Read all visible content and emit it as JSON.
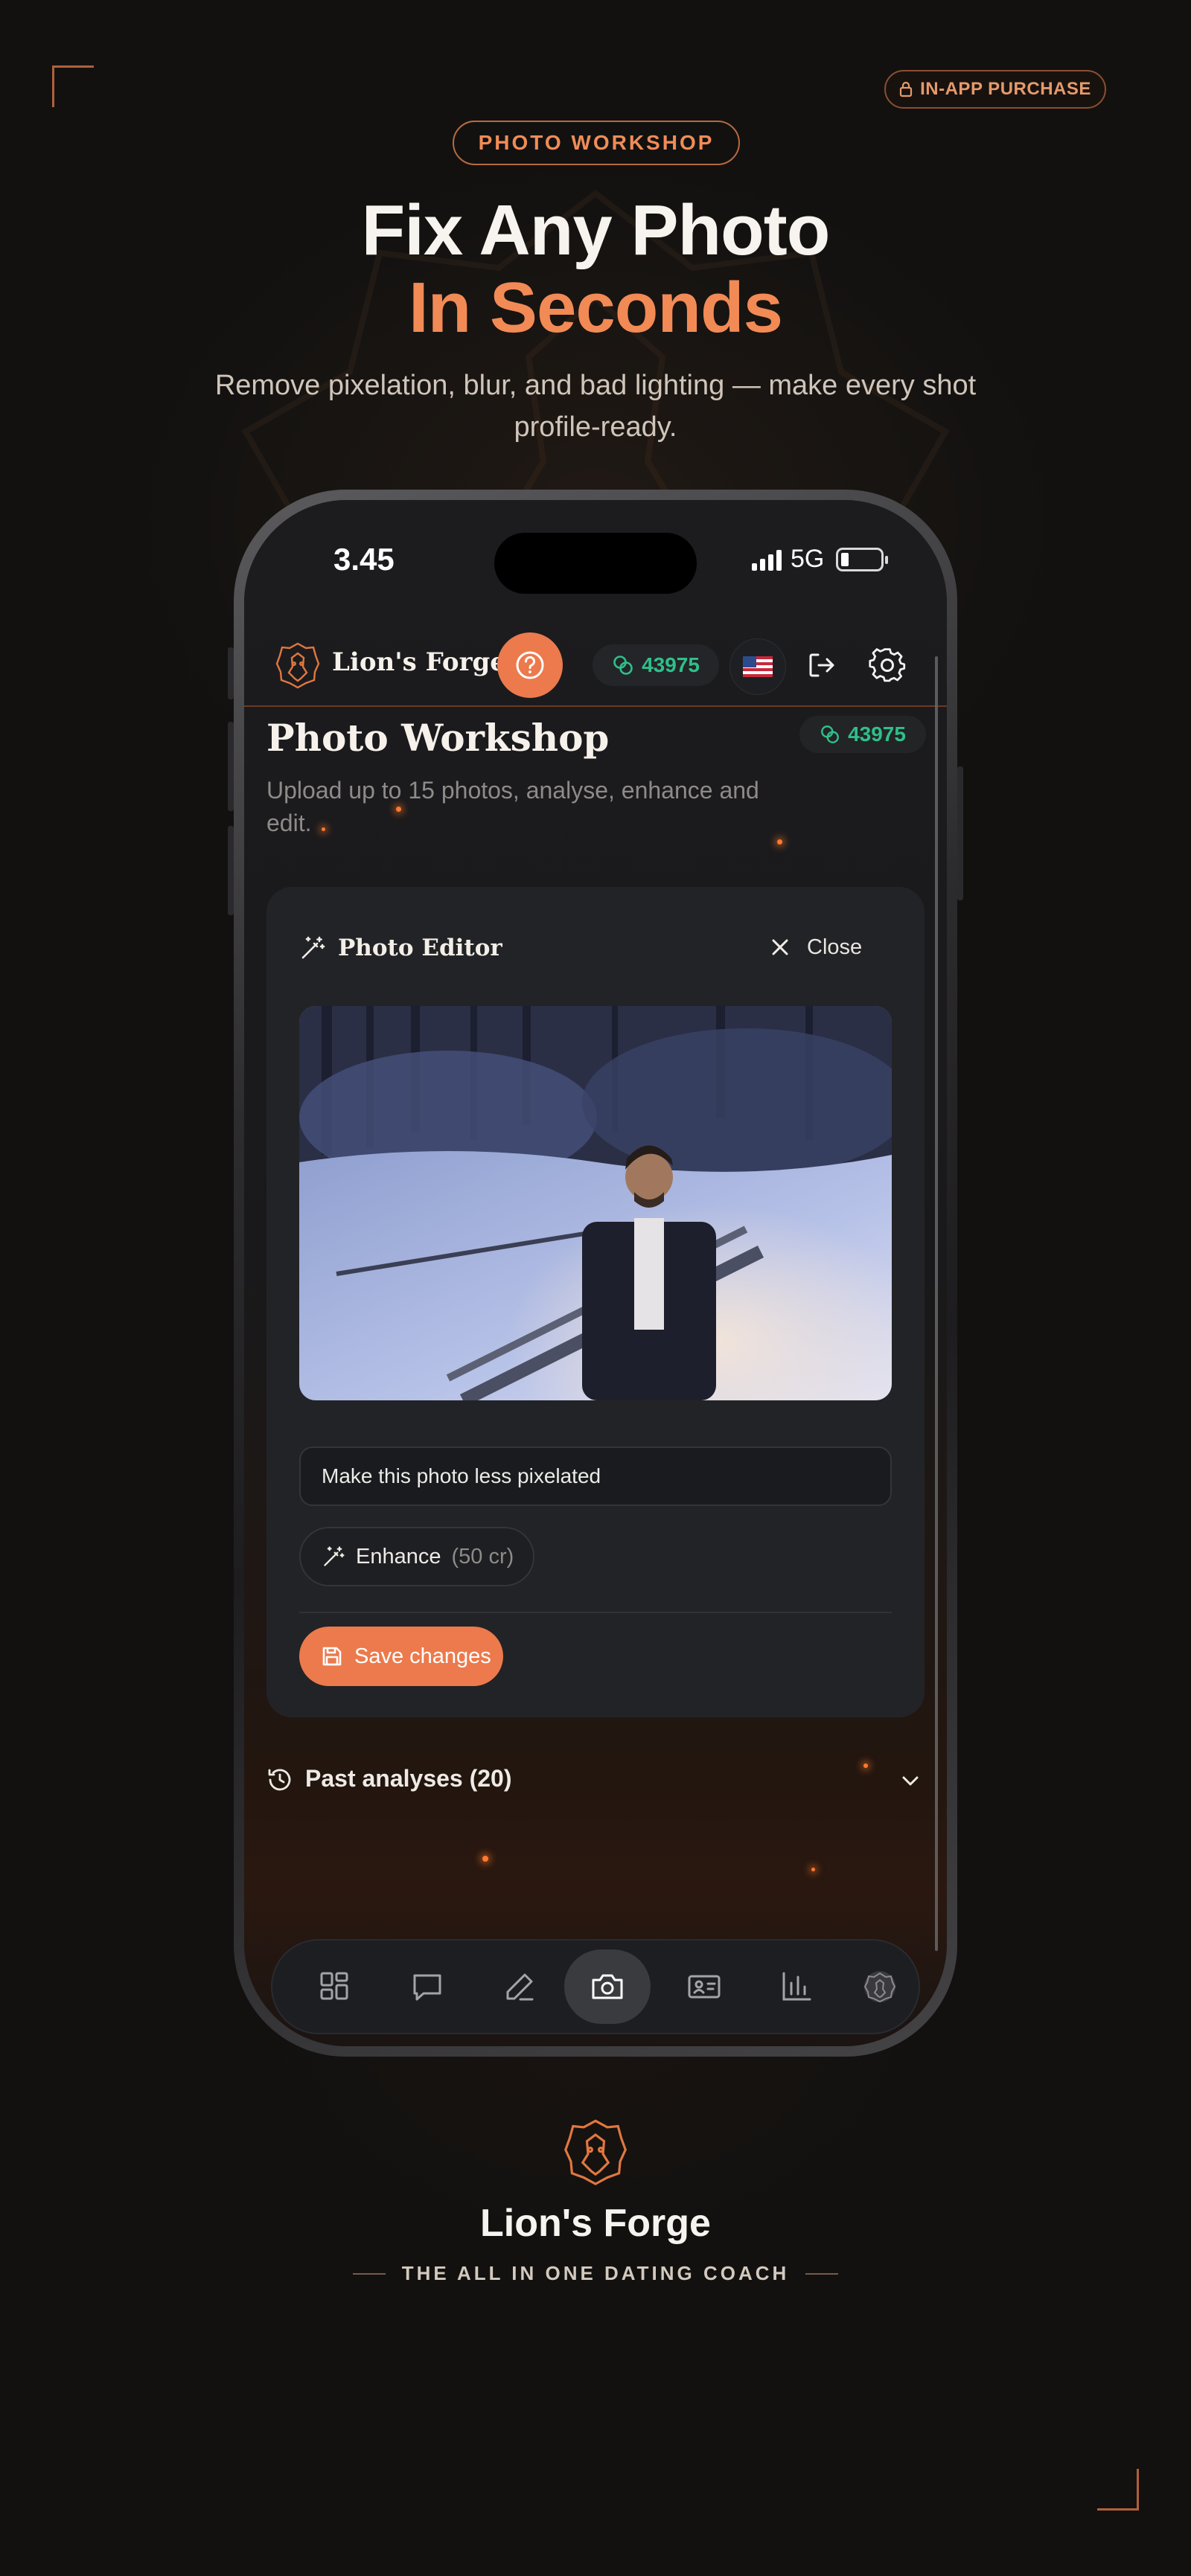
{
  "badges": {
    "in_app_purchase": "IN-APP PURCHASE",
    "section": "PHOTO WORKSHOP"
  },
  "hero": {
    "title_line1": "Fix Any Photo",
    "title_line2": "In Seconds",
    "subtitle": "Remove pixelation, blur, and bad lighting — make every shot profile-ready."
  },
  "status_bar": {
    "time": "3.45",
    "network": "5G"
  },
  "app_header": {
    "brand": "Lion's Forge",
    "credits": "43975",
    "flag": "🇺🇸"
  },
  "workshop": {
    "title": "Photo Workshop",
    "credits": "43975",
    "subtitle": "Upload up to 15 photos, analyse, enhance and edit."
  },
  "editor": {
    "title": "Photo Editor",
    "close_label": "Close",
    "prompt_value": "Make this photo less pixelated",
    "enhance_label": "Enhance",
    "enhance_cost": "(50 cr)",
    "save_label": "Save changes"
  },
  "past_analyses": {
    "label": "Past analyses (20)"
  },
  "bottom_nav": {
    "items": [
      "grid-icon",
      "chat-icon",
      "pen-icon",
      "camera-icon",
      "id-card-icon",
      "bar-chart-icon",
      "lion-avatar-icon"
    ],
    "active": "camera-icon"
  },
  "footer": {
    "brand": "Lion's Forge",
    "tagline": "THE ALL IN ONE DATING COACH"
  },
  "colors": {
    "accent": "#ec7a4c",
    "credits_green": "#2fbf8a",
    "background": "#121110"
  }
}
